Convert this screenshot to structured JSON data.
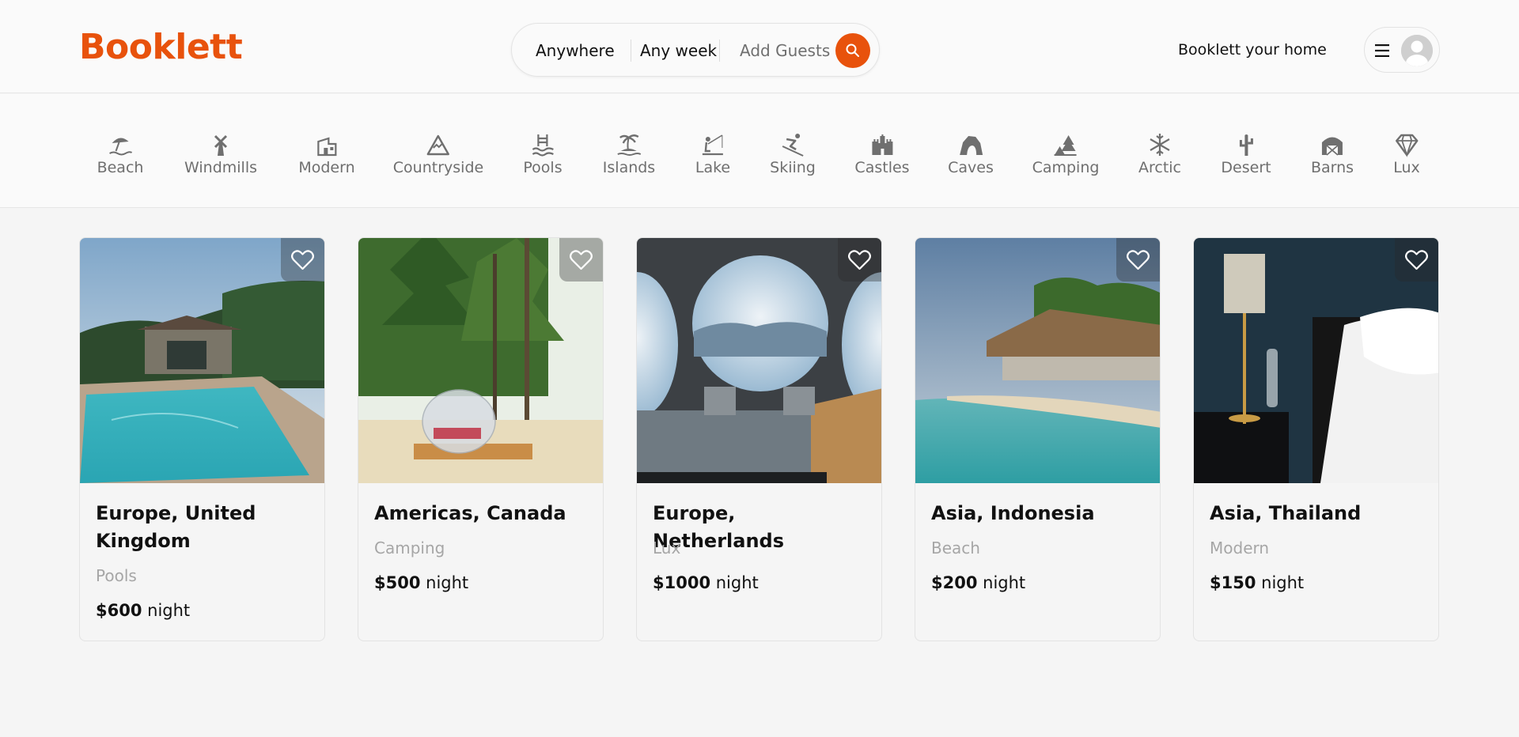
{
  "brand": {
    "name": "Booklett",
    "accent": "#e8520c"
  },
  "search": {
    "where": "Anywhere",
    "when": "Any week",
    "guests": "Add Guests"
  },
  "header": {
    "host_link": "Booklett your home"
  },
  "categories": [
    {
      "label": "Beach",
      "icon": "beach-umbrella-icon"
    },
    {
      "label": "Windmills",
      "icon": "windmill-icon"
    },
    {
      "label": "Modern",
      "icon": "modern-house-icon"
    },
    {
      "label": "Countryside",
      "icon": "mountain-icon"
    },
    {
      "label": "Pools",
      "icon": "pool-ladder-icon"
    },
    {
      "label": "Islands",
      "icon": "island-palm-icon"
    },
    {
      "label": "Lake",
      "icon": "fishing-icon"
    },
    {
      "label": "Skiing",
      "icon": "skier-icon"
    },
    {
      "label": "Castles",
      "icon": "castle-icon"
    },
    {
      "label": "Caves",
      "icon": "cave-icon"
    },
    {
      "label": "Camping",
      "icon": "tent-tree-icon"
    },
    {
      "label": "Arctic",
      "icon": "snowflake-icon"
    },
    {
      "label": "Desert",
      "icon": "cactus-icon"
    },
    {
      "label": "Barns",
      "icon": "barn-icon"
    },
    {
      "label": "Lux",
      "icon": "diamond-icon"
    }
  ],
  "listings": [
    {
      "location": "Europe, United Kingdom",
      "category": "Pools",
      "price": "$600",
      "unit": "night"
    },
    {
      "location": "Americas, Canada",
      "category": "Camping",
      "price": "$500",
      "unit": "night"
    },
    {
      "location": "Europe, Netherlands",
      "category": "Lux",
      "price": "$1000",
      "unit": "night"
    },
    {
      "location": "Asia, Indonesia",
      "category": "Beach",
      "price": "$200",
      "unit": "night"
    },
    {
      "location": "Asia, Thailand",
      "category": "Modern",
      "price": "$150",
      "unit": "night"
    }
  ]
}
